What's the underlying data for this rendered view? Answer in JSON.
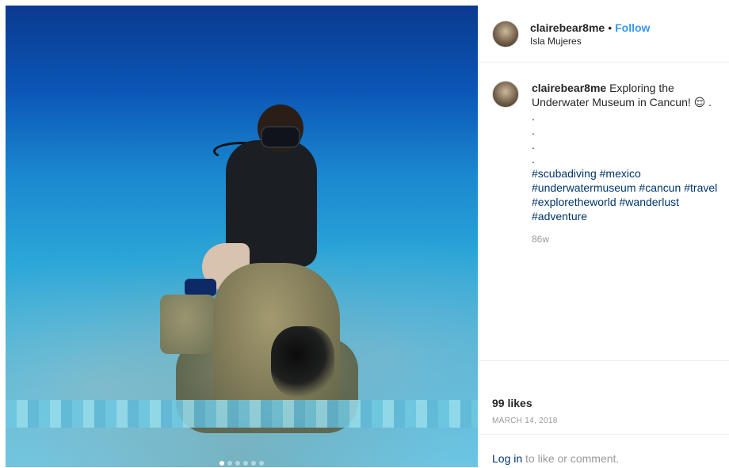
{
  "post": {
    "username": "clairebear8me",
    "separator": "•",
    "follow_label": "Follow",
    "location": "Isla Mujeres",
    "caption_text": "Exploring the Underwater Museum in Cancun! 😌 .",
    "caption_dots": [
      ".",
      ".",
      ".",
      "."
    ],
    "hashtags_line1": [
      "#scubadiving",
      "#mexico"
    ],
    "hashtags_line2": [
      "#underwatermuseum",
      "#cancun",
      "#travel"
    ],
    "hashtags_line3": [
      "#exploretheworld",
      "#wanderlust"
    ],
    "hashtags_line4": [
      "#adventure"
    ],
    "time_ago": "86w",
    "likes": "99 likes",
    "date": "MARCH 14, 2018",
    "login_link": "Log in",
    "login_suffix": " to like or comment.",
    "carousel_count": 6,
    "carousel_active": 0
  },
  "colors": {
    "link": "#003569",
    "follow": "#3897f0",
    "muted": "#999999",
    "text": "#262626",
    "border": "#efefef"
  }
}
